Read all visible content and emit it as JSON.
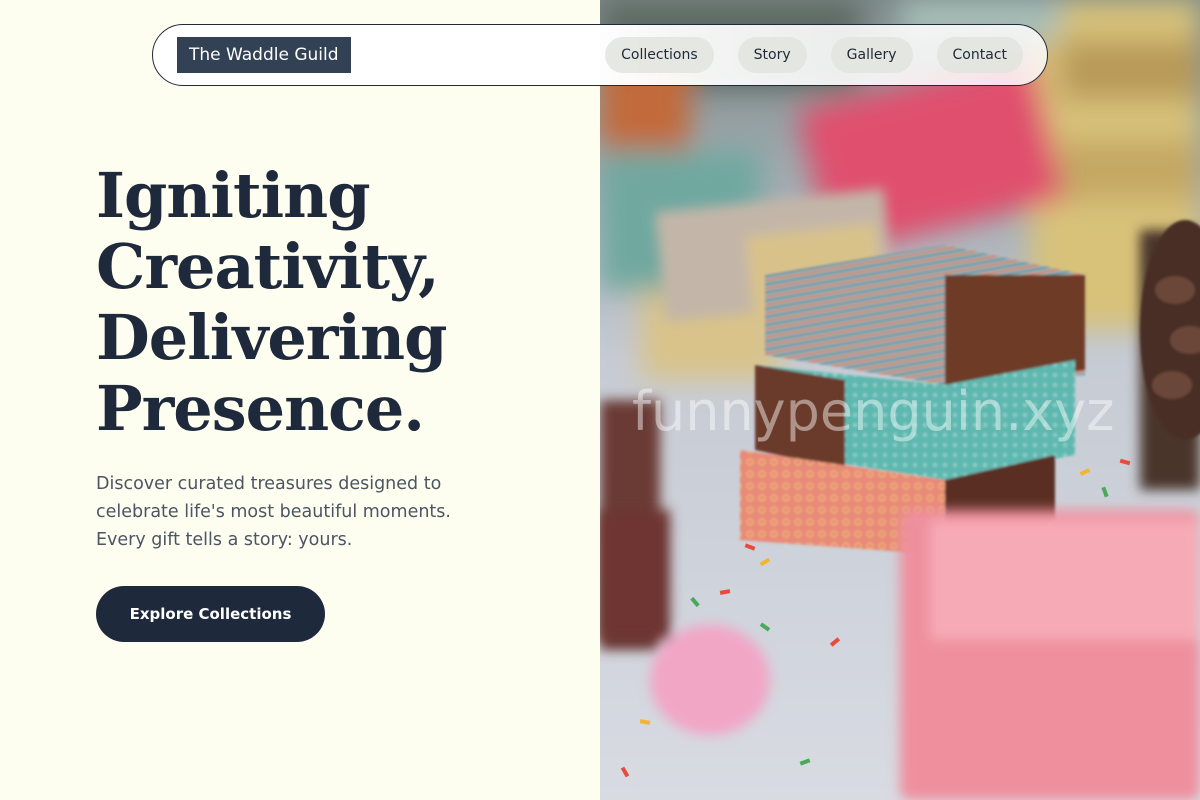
{
  "brand": {
    "name": "The Waddle Guild"
  },
  "nav": {
    "items": [
      {
        "label": "Collections"
      },
      {
        "label": "Story"
      },
      {
        "label": "Gallery"
      },
      {
        "label": "Contact"
      }
    ]
  },
  "hero": {
    "headline_lines": [
      "Igniting",
      "Creativity,",
      "Delivering",
      "Presence."
    ],
    "subtext_lines": [
      "Discover curated treasures designed to",
      "celebrate life's most beautiful moments.",
      "Every gift tells a story: yours."
    ],
    "cta_label": "Explore Collections"
  },
  "image": {
    "watermark": "funnypenguin.xyz"
  },
  "colors": {
    "page_background": "#fefef0",
    "brand_background": "#334155",
    "heading": "#1e293b",
    "body_text": "#4b5563",
    "button": "#1e293b",
    "nav_pill": "#e2e4de"
  }
}
